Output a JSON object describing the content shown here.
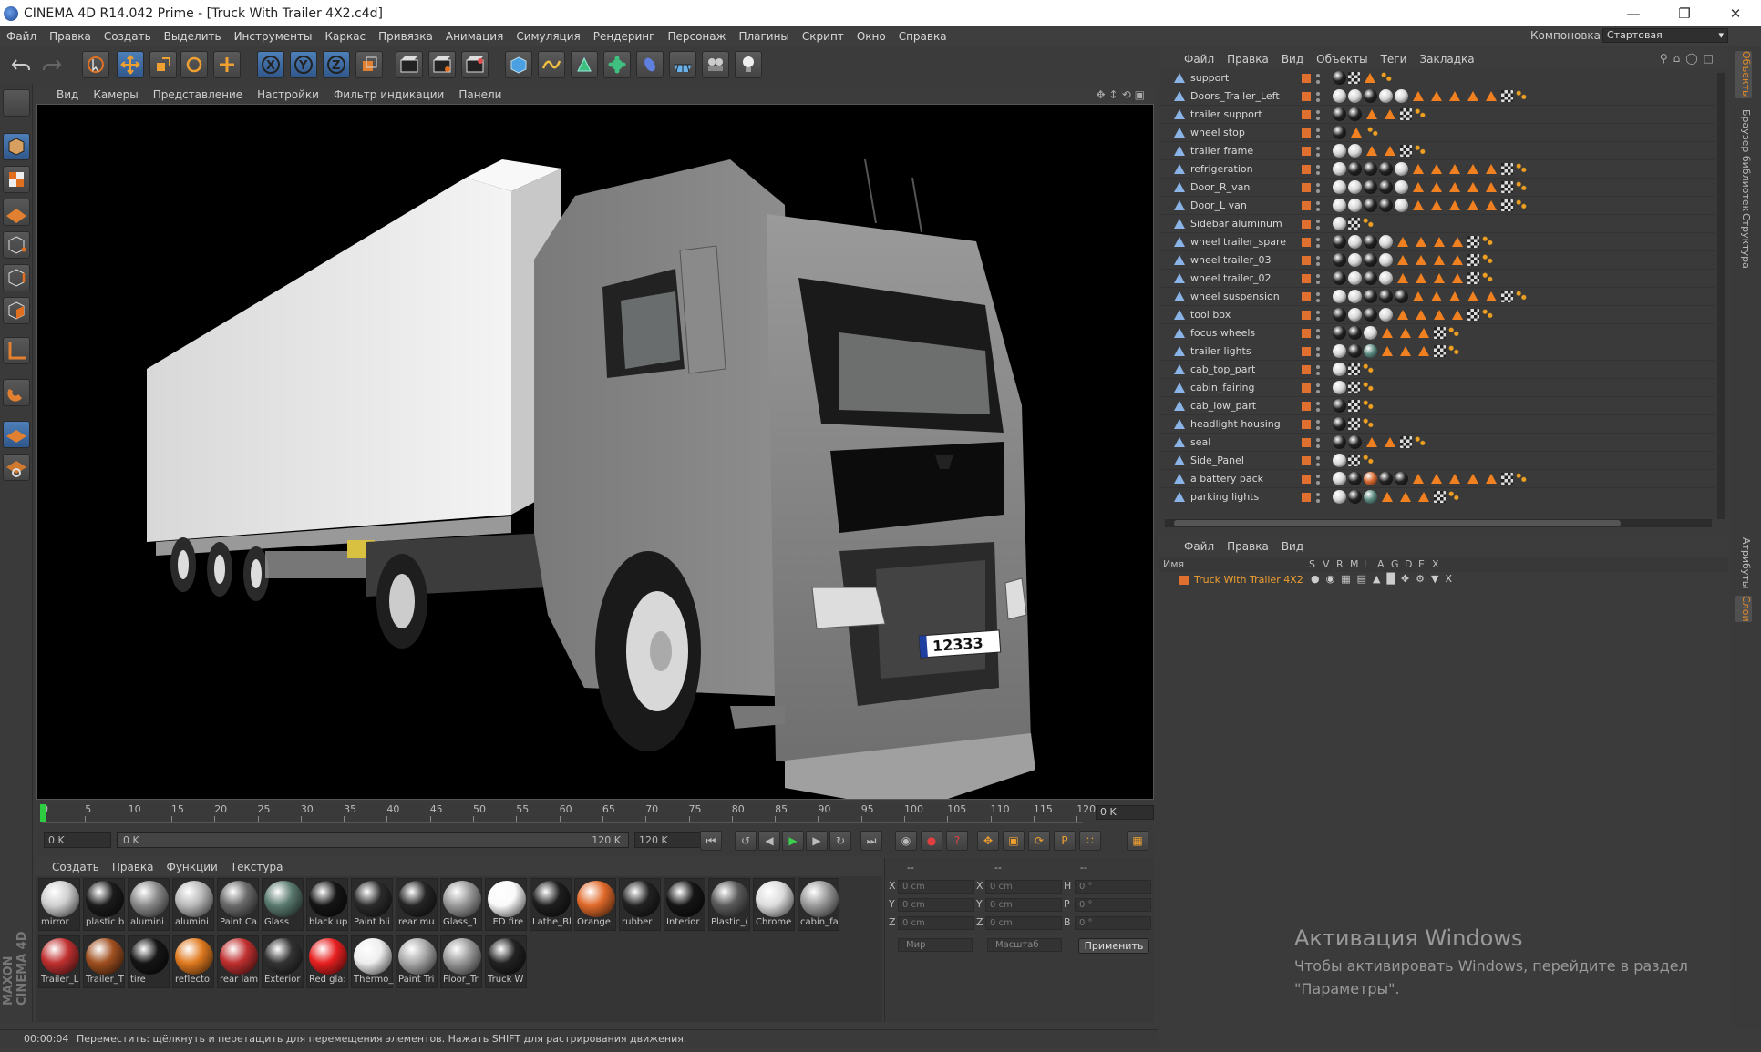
{
  "window": {
    "title": "CINEMA 4D R14.042 Prime - [Truck With Trailer 4X2.c4d]"
  },
  "menubar": {
    "items": [
      "Файл",
      "Правка",
      "Создать",
      "Выделить",
      "Инструменты",
      "Каркас",
      "Привязка",
      "Анимация",
      "Симуляция",
      "Рендеринг",
      "Персонаж",
      "Плагины",
      "Скрипт",
      "Окно",
      "Справка"
    ],
    "layout_label": "Компоновка",
    "layout_value": "Стартовая"
  },
  "viewport": {
    "menu": [
      "Вид",
      "Камеры",
      "Представление",
      "Настройки",
      "Фильтр индикации",
      "Панели"
    ],
    "plate": "12333"
  },
  "timeline": {
    "ticks": [
      "0",
      "5",
      "10",
      "15",
      "20",
      "25",
      "30",
      "35",
      "40",
      "45",
      "50",
      "55",
      "60",
      "65",
      "70",
      "75",
      "80",
      "85",
      "90",
      "95",
      "100",
      "105",
      "110",
      "115",
      "120"
    ],
    "current_frame": "0 K",
    "start_field": "0 K",
    "range_start": "0 K",
    "range_end": "120 K",
    "end_field": "120 K"
  },
  "materials": {
    "menu": [
      "Создать",
      "Правка",
      "Функции",
      "Текстура"
    ],
    "row1": [
      "mirror",
      "plastic b",
      "alumini",
      "alumini",
      "Paint Ca",
      "Glass",
      "black up",
      "Paint bli",
      "rear mu",
      "Glass_1",
      "LED fire",
      "Lathe_Bl",
      "Orange",
      "rubber",
      "Interior",
      "Plastic_(",
      "Chrome",
      "cabin_fa"
    ],
    "row2": [
      "Trailer_L",
      "Trailer_T",
      "tire",
      "reflecto",
      "rear lam",
      "Exterior",
      "Red gla:",
      "Thermo_",
      "Paint Tri",
      "Floor_Tr",
      "Truck W"
    ]
  },
  "coords": {
    "headers": [
      "--",
      "--",
      "--"
    ],
    "rows": [
      {
        "a": "X",
        "av": "0 cm",
        "b": "X",
        "bv": "0 cm",
        "c": "H",
        "cv": "0 °"
      },
      {
        "a": "Y",
        "av": "0 cm",
        "b": "Y",
        "bv": "0 cm",
        "c": "P",
        "cv": "0 °"
      },
      {
        "a": "Z",
        "av": "0 cm",
        "b": "Z",
        "bv": "0 cm",
        "c": "B",
        "cv": "0 °"
      }
    ],
    "world": "Мир",
    "scale": "Масштаб",
    "apply": "Применить"
  },
  "statusbar": {
    "time": "00:00:04",
    "message": "Переместить: щёлкнуть и перетащить для перемещения элементов. Нажать SHIFT для растрирования движения."
  },
  "objects": {
    "menu": [
      "Файл",
      "Правка",
      "Вид",
      "Объекты",
      "Теги",
      "Закладка"
    ],
    "items": [
      {
        "name": "support",
        "tags": "bcTD"
      },
      {
        "name": "Doors_Trailer_Left",
        "tags": "wwbwwTTTTTCD"
      },
      {
        "name": "trailer support",
        "tags": "bbTTCD"
      },
      {
        "name": "wheel stop",
        "tags": "bTD"
      },
      {
        "name": "trailer frame",
        "tags": "wwTTCD"
      },
      {
        "name": "refrigeration",
        "tags": "wbbbwTTTTTCD"
      },
      {
        "name": "Door_R_van",
        "tags": "wwbbwTTTTTCD"
      },
      {
        "name": "Door_L van",
        "tags": "wwbbwTTTTTCD"
      },
      {
        "name": "Sidebar aluminum",
        "tags": "wcD"
      },
      {
        "name": "wheel trailer_spare",
        "tags": "bwbwTTTTCD"
      },
      {
        "name": "wheel trailer_03",
        "tags": "bwbwTTTTCD"
      },
      {
        "name": "wheel trailer_02",
        "tags": "bwbwTTTTCD"
      },
      {
        "name": "wheel suspension",
        "tags": "wwbbbTTTTTCD"
      },
      {
        "name": "tool box",
        "tags": "bwbwTTTTCD"
      },
      {
        "name": "focus wheels",
        "tags": "bbwTTTCD"
      },
      {
        "name": "trailer lights",
        "tags": "wbgTTTCD"
      },
      {
        "name": "cab_top_part",
        "tags": "wcD"
      },
      {
        "name": "cabin_fairing",
        "tags": "wcD"
      },
      {
        "name": "cab_low_part",
        "tags": "bcD"
      },
      {
        "name": "headlight housing",
        "tags": "bcD"
      },
      {
        "name": "seal",
        "tags": "bbTTCD"
      },
      {
        "name": "Side_Panel",
        "tags": "wcD"
      },
      {
        "name": "a battery pack",
        "tags": "wbobbTTTTTCD"
      },
      {
        "name": "parking lights",
        "tags": "wbgTTTCD"
      }
    ]
  },
  "layers": {
    "menu": [
      "Файл",
      "Правка",
      "Вид"
    ],
    "header_name": "Имя",
    "columns": [
      "S",
      "V",
      "R",
      "M",
      "L",
      "A",
      "G",
      "D",
      "E",
      "X"
    ],
    "row_name": "Truck With Trailer 4X2"
  },
  "watermark": {
    "title": "Активация Windows",
    "subtitle": "Чтобы активировать Windows, перейдите в раздел \"Параметры\"."
  },
  "side_tabs": [
    "Объекты",
    "Браузер библиотек",
    "Структура",
    "Атрибуты",
    "Слои"
  ],
  "maxon": "MAXON CINEMA 4D"
}
